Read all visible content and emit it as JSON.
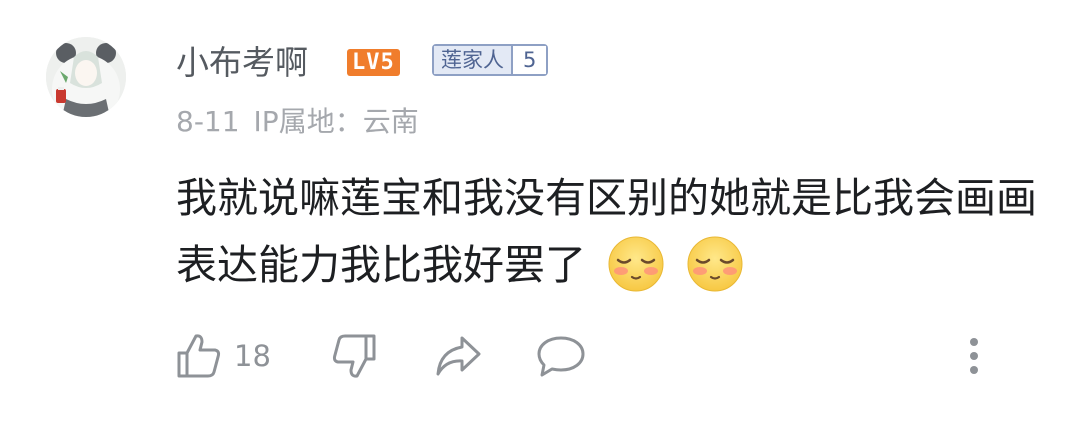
{
  "comment": {
    "username": "小布考啊",
    "level_badge": "LV5",
    "fan_badge": {
      "name": "莲家人",
      "level": "5"
    },
    "date": "8-11",
    "ip_location": "IP属地：云南",
    "text": "我就说嘛莲宝和我没有区别的她就是比我会画画表达能力我比我好罢了",
    "emojis": [
      "sleepy-face-emoji",
      "sleepy-face-emoji"
    ],
    "like_count": "18"
  },
  "actions": {
    "icons": [
      "thumbs-up-icon",
      "thumbs-down-icon",
      "share-icon",
      "reply-icon",
      "more-icon"
    ]
  },
  "colors": {
    "level_badge_bg": "#f07d2c",
    "fan_badge_border": "#8ea0c4",
    "fan_badge_bg": "#e3e9f5",
    "username": "#555a60",
    "meta": "#a5a8ad",
    "text": "#1d1f22",
    "icon": "#8e9297"
  }
}
